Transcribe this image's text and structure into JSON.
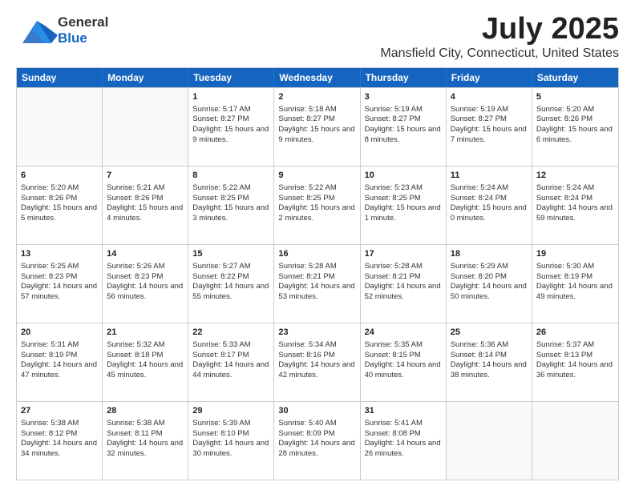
{
  "logo": {
    "general": "General",
    "blue": "Blue"
  },
  "title": "July 2025",
  "subtitle": "Mansfield City, Connecticut, United States",
  "days_of_week": [
    "Sunday",
    "Monday",
    "Tuesday",
    "Wednesday",
    "Thursday",
    "Friday",
    "Saturday"
  ],
  "weeks": [
    [
      {
        "day": "",
        "empty": true
      },
      {
        "day": "",
        "empty": true
      },
      {
        "day": "1",
        "sunrise": "Sunrise: 5:17 AM",
        "sunset": "Sunset: 8:27 PM",
        "daylight": "Daylight: 15 hours and 9 minutes."
      },
      {
        "day": "2",
        "sunrise": "Sunrise: 5:18 AM",
        "sunset": "Sunset: 8:27 PM",
        "daylight": "Daylight: 15 hours and 9 minutes."
      },
      {
        "day": "3",
        "sunrise": "Sunrise: 5:19 AM",
        "sunset": "Sunset: 8:27 PM",
        "daylight": "Daylight: 15 hours and 8 minutes."
      },
      {
        "day": "4",
        "sunrise": "Sunrise: 5:19 AM",
        "sunset": "Sunset: 8:27 PM",
        "daylight": "Daylight: 15 hours and 7 minutes."
      },
      {
        "day": "5",
        "sunrise": "Sunrise: 5:20 AM",
        "sunset": "Sunset: 8:26 PM",
        "daylight": "Daylight: 15 hours and 6 minutes."
      }
    ],
    [
      {
        "day": "6",
        "sunrise": "Sunrise: 5:20 AM",
        "sunset": "Sunset: 8:26 PM",
        "daylight": "Daylight: 15 hours and 5 minutes."
      },
      {
        "day": "7",
        "sunrise": "Sunrise: 5:21 AM",
        "sunset": "Sunset: 8:26 PM",
        "daylight": "Daylight: 15 hours and 4 minutes."
      },
      {
        "day": "8",
        "sunrise": "Sunrise: 5:22 AM",
        "sunset": "Sunset: 8:25 PM",
        "daylight": "Daylight: 15 hours and 3 minutes."
      },
      {
        "day": "9",
        "sunrise": "Sunrise: 5:22 AM",
        "sunset": "Sunset: 8:25 PM",
        "daylight": "Daylight: 15 hours and 2 minutes."
      },
      {
        "day": "10",
        "sunrise": "Sunrise: 5:23 AM",
        "sunset": "Sunset: 8:25 PM",
        "daylight": "Daylight: 15 hours and 1 minute."
      },
      {
        "day": "11",
        "sunrise": "Sunrise: 5:24 AM",
        "sunset": "Sunset: 8:24 PM",
        "daylight": "Daylight: 15 hours and 0 minutes."
      },
      {
        "day": "12",
        "sunrise": "Sunrise: 5:24 AM",
        "sunset": "Sunset: 8:24 PM",
        "daylight": "Daylight: 14 hours and 59 minutes."
      }
    ],
    [
      {
        "day": "13",
        "sunrise": "Sunrise: 5:25 AM",
        "sunset": "Sunset: 8:23 PM",
        "daylight": "Daylight: 14 hours and 57 minutes."
      },
      {
        "day": "14",
        "sunrise": "Sunrise: 5:26 AM",
        "sunset": "Sunset: 8:23 PM",
        "daylight": "Daylight: 14 hours and 56 minutes."
      },
      {
        "day": "15",
        "sunrise": "Sunrise: 5:27 AM",
        "sunset": "Sunset: 8:22 PM",
        "daylight": "Daylight: 14 hours and 55 minutes."
      },
      {
        "day": "16",
        "sunrise": "Sunrise: 5:28 AM",
        "sunset": "Sunset: 8:21 PM",
        "daylight": "Daylight: 14 hours and 53 minutes."
      },
      {
        "day": "17",
        "sunrise": "Sunrise: 5:28 AM",
        "sunset": "Sunset: 8:21 PM",
        "daylight": "Daylight: 14 hours and 52 minutes."
      },
      {
        "day": "18",
        "sunrise": "Sunrise: 5:29 AM",
        "sunset": "Sunset: 8:20 PM",
        "daylight": "Daylight: 14 hours and 50 minutes."
      },
      {
        "day": "19",
        "sunrise": "Sunrise: 5:30 AM",
        "sunset": "Sunset: 8:19 PM",
        "daylight": "Daylight: 14 hours and 49 minutes."
      }
    ],
    [
      {
        "day": "20",
        "sunrise": "Sunrise: 5:31 AM",
        "sunset": "Sunset: 8:19 PM",
        "daylight": "Daylight: 14 hours and 47 minutes."
      },
      {
        "day": "21",
        "sunrise": "Sunrise: 5:32 AM",
        "sunset": "Sunset: 8:18 PM",
        "daylight": "Daylight: 14 hours and 45 minutes."
      },
      {
        "day": "22",
        "sunrise": "Sunrise: 5:33 AM",
        "sunset": "Sunset: 8:17 PM",
        "daylight": "Daylight: 14 hours and 44 minutes."
      },
      {
        "day": "23",
        "sunrise": "Sunrise: 5:34 AM",
        "sunset": "Sunset: 8:16 PM",
        "daylight": "Daylight: 14 hours and 42 minutes."
      },
      {
        "day": "24",
        "sunrise": "Sunrise: 5:35 AM",
        "sunset": "Sunset: 8:15 PM",
        "daylight": "Daylight: 14 hours and 40 minutes."
      },
      {
        "day": "25",
        "sunrise": "Sunrise: 5:36 AM",
        "sunset": "Sunset: 8:14 PM",
        "daylight": "Daylight: 14 hours and 38 minutes."
      },
      {
        "day": "26",
        "sunrise": "Sunrise: 5:37 AM",
        "sunset": "Sunset: 8:13 PM",
        "daylight": "Daylight: 14 hours and 36 minutes."
      }
    ],
    [
      {
        "day": "27",
        "sunrise": "Sunrise: 5:38 AM",
        "sunset": "Sunset: 8:12 PM",
        "daylight": "Daylight: 14 hours and 34 minutes."
      },
      {
        "day": "28",
        "sunrise": "Sunrise: 5:38 AM",
        "sunset": "Sunset: 8:11 PM",
        "daylight": "Daylight: 14 hours and 32 minutes."
      },
      {
        "day": "29",
        "sunrise": "Sunrise: 5:39 AM",
        "sunset": "Sunset: 8:10 PM",
        "daylight": "Daylight: 14 hours and 30 minutes."
      },
      {
        "day": "30",
        "sunrise": "Sunrise: 5:40 AM",
        "sunset": "Sunset: 8:09 PM",
        "daylight": "Daylight: 14 hours and 28 minutes."
      },
      {
        "day": "31",
        "sunrise": "Sunrise: 5:41 AM",
        "sunset": "Sunset: 8:08 PM",
        "daylight": "Daylight: 14 hours and 26 minutes."
      },
      {
        "day": "",
        "empty": true
      },
      {
        "day": "",
        "empty": true
      }
    ]
  ]
}
